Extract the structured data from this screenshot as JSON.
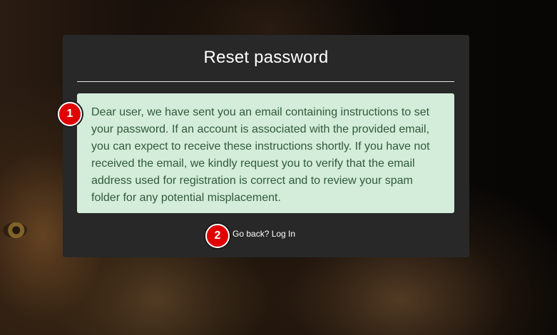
{
  "dialog": {
    "title": "Reset password",
    "message": "Dear user, we have sent you an email containing instructions to set your password. If an account is associated with the provided email, you can expect to receive these instructions shortly. If you have not received the email, we kindly request you to verify that the email address used for registration is correct and to review your spam folder for any potential misplacement.",
    "back_link": "Go back? Log In"
  },
  "markers": [
    "1",
    "2"
  ],
  "colors": {
    "card_bg": "#282828",
    "alert_bg": "#d4edda",
    "alert_text": "#2f5a3a",
    "marker": "#e00000"
  }
}
